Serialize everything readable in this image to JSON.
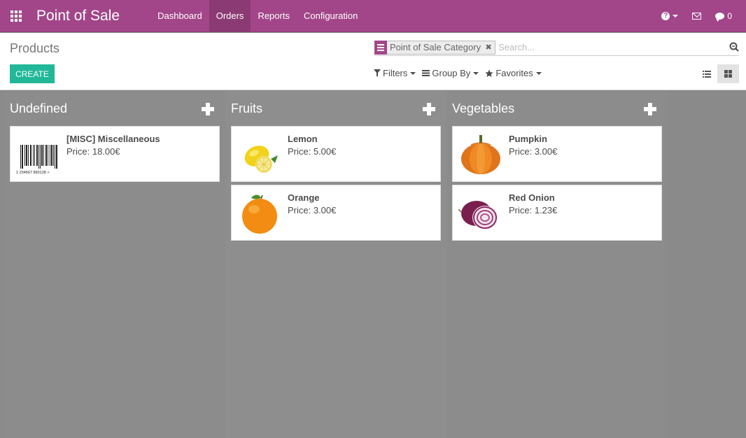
{
  "navbar": {
    "app_title": "Point of Sale",
    "menu": [
      "Dashboard",
      "Orders",
      "Reports",
      "Configuration"
    ],
    "active_menu": "Orders",
    "chat_count": "0"
  },
  "control_panel": {
    "breadcrumb": "Products",
    "create_label": "CREATE",
    "search": {
      "facet_value": "Point of Sale Category",
      "placeholder": "Search..."
    },
    "filters_label": "Filters",
    "groupby_label": "Group By",
    "favorites_label": "Favorites"
  },
  "kanban": {
    "columns": [
      {
        "title": "Undefined",
        "cards": [
          {
            "name": "[MISC] Miscellaneous",
            "price": "Price: 18.00€",
            "image": "barcode"
          }
        ]
      },
      {
        "title": "Fruits",
        "cards": [
          {
            "name": "Lemon",
            "price": "Price: 5.00€",
            "image": "lemon"
          },
          {
            "name": "Orange",
            "price": "Price: 3.00€",
            "image": "orange"
          }
        ]
      },
      {
        "title": "Vegetables",
        "cards": [
          {
            "name": "Pumpkin",
            "price": "Price: 3.00€",
            "image": "pumpkin"
          },
          {
            "name": "Red Onion",
            "price": "Price: 1.23€",
            "image": "red-onion"
          }
        ]
      }
    ]
  },
  "barcode_text": "1 234567 890128 >",
  "colors": {
    "brand": "#a24689",
    "create_button": "#21b799",
    "kanban_background": "#8a8a8a"
  }
}
